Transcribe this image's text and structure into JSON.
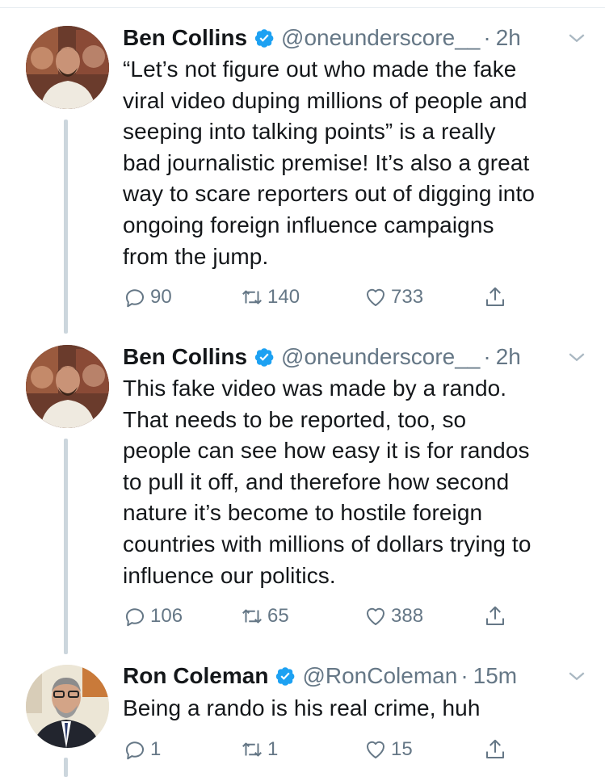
{
  "tweets": [
    {
      "name": "Ben Collins",
      "handle": "@oneunderscore__",
      "separator": "·",
      "time": "2h",
      "text": "“Let’s not figure out who made the fake\nviral video duping millions of people and\nseeping into talking points” is a really\nbad journalistic premise! It’s also a great\nway to scare reporters out of digging into\nongoing foreign influence campaigns\nfrom the jump.",
      "replies": "90",
      "retweets": "140",
      "likes": "733"
    },
    {
      "name": "Ben Collins",
      "handle": "@oneunderscore__",
      "separator": "·",
      "time": "2h",
      "text": "This fake video was made by a rando.\nThat needs to be reported, too, so\npeople can see how easy it is for randos\nto pull it off, and therefore how second\nnature it’s become to hostile foreign\ncountries with millions of dollars trying to\ninfluence our politics.",
      "replies": "106",
      "retweets": "65",
      "likes": "388"
    },
    {
      "name": "Ron Coleman",
      "handle": "@RonColeman",
      "separator": "·",
      "time": "15m",
      "text": "Being a rando is his real crime, huh",
      "replies": "1",
      "retweets": "1",
      "likes": "15"
    }
  ],
  "colors": {
    "text": "#14171a",
    "secondary": "#657786",
    "verified": "#1da1f2",
    "thread_line": "#ccd6dd"
  },
  "icons": [
    "reply-icon",
    "retweet-icon",
    "like-icon",
    "share-icon",
    "verified-badge-icon",
    "chevron-down-icon"
  ]
}
